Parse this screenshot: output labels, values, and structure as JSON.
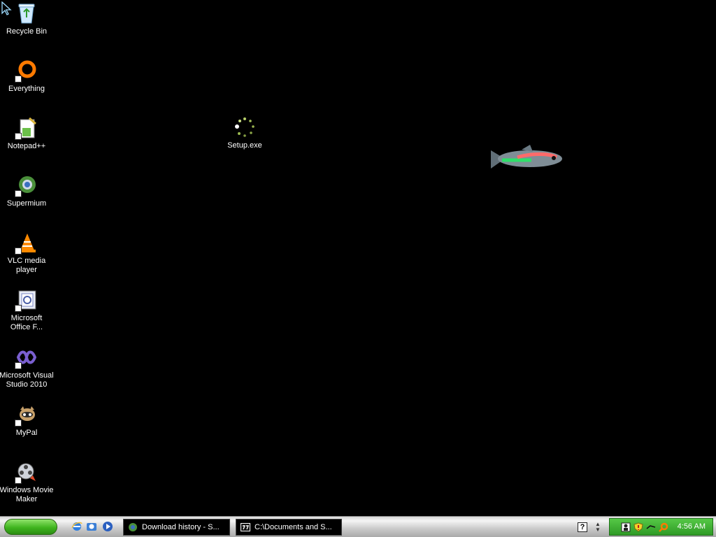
{
  "desktop": {
    "icons": [
      {
        "label": "Recycle Bin",
        "icon": "recycle-bin-icon"
      },
      {
        "label": "Everything",
        "icon": "everything-icon"
      },
      {
        "label": "Notepad++",
        "icon": "notepadpp-icon"
      },
      {
        "label": "Supermium",
        "icon": "supermium-icon"
      },
      {
        "label": "VLC media\nplayer",
        "icon": "vlc-icon"
      },
      {
        "label": "Microsoft\nOffice F...",
        "icon": "office-icon"
      },
      {
        "label": "Microsoft Visual\nStudio 2010",
        "icon": "visual-studio-icon"
      },
      {
        "label": "MyPal",
        "icon": "mypal-icon"
      },
      {
        "label": "Windows Movie\nMaker",
        "icon": "movie-maker-icon"
      }
    ],
    "setup": {
      "label": "Setup.exe",
      "icon": "loading-spinner-icon"
    }
  },
  "taskbar": {
    "tasks": [
      {
        "label": "Download history - S...",
        "icon": "supermium-icon"
      },
      {
        "label": "C:\\Documents and S...",
        "icon": "7zip-icon"
      }
    ],
    "clock": "4:56 AM",
    "help_label": "?"
  }
}
